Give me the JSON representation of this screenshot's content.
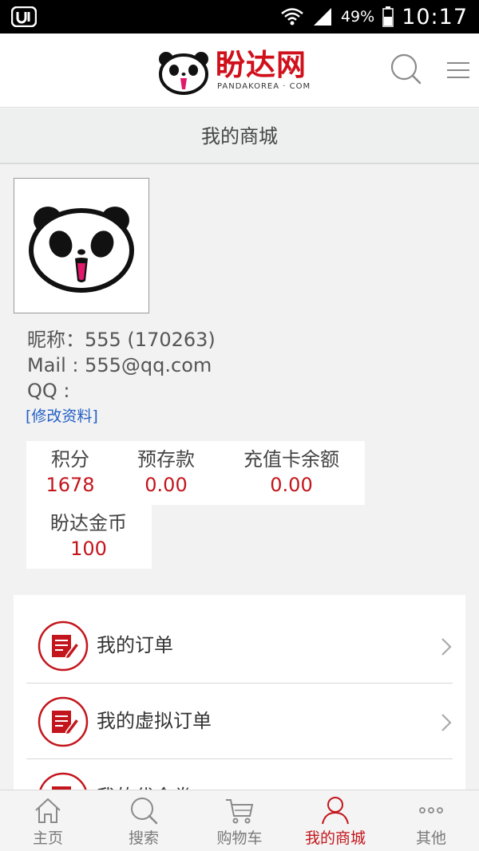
{
  "status_bar": {
    "battery": "49%",
    "time": "10:17"
  },
  "header": {
    "logo_cn": "盼达网",
    "logo_en": "PANDAKOREA · COM"
  },
  "page_title": "我的商城",
  "profile": {
    "nickname_line": "昵称：555 (170263)",
    "mail_line": "Mail : 555@qq.com",
    "qq_line": "QQ :",
    "edit_link": "[修改资料]"
  },
  "stats": [
    {
      "label": "积分",
      "value": "1678"
    },
    {
      "label": "预存款",
      "value": "0.00"
    },
    {
      "label": "充值卡余额",
      "value": "0.00"
    },
    {
      "label": "盼达金币",
      "value": "100"
    }
  ],
  "menu": [
    {
      "label": "我的订单",
      "icon": "order-icon"
    },
    {
      "label": "我的虚拟订单",
      "icon": "order-icon"
    },
    {
      "label": "我的代金券",
      "icon": "order-icon"
    }
  ],
  "bottom_nav": [
    {
      "label": "主页",
      "icon": "home-icon"
    },
    {
      "label": "搜索",
      "icon": "search-icon"
    },
    {
      "label": "购物车",
      "icon": "cart-icon"
    },
    {
      "label": "我的商城",
      "icon": "user-icon",
      "active": true
    },
    {
      "label": "其他",
      "icon": "more-icon"
    }
  ],
  "colors": {
    "accent": "#c3161c",
    "link": "#2460c6",
    "brand": "#d0101b"
  }
}
